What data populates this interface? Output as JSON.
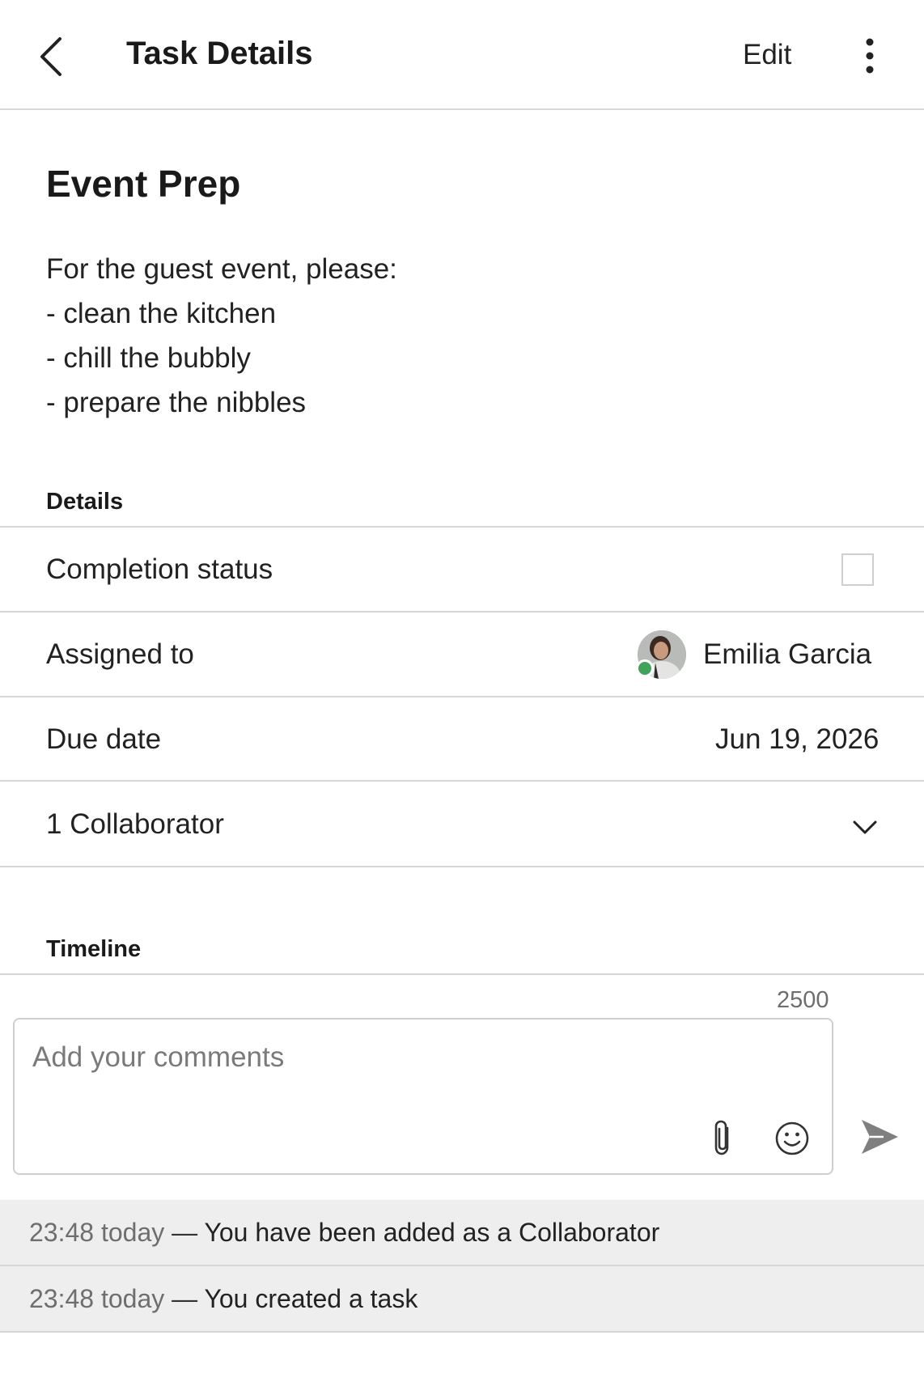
{
  "header": {
    "title": "Task Details",
    "edit_label": "Edit"
  },
  "task": {
    "title": "Event Prep",
    "description_lines": [
      "For the guest event, please:",
      "- clean the kitchen",
      "- chill the bubbly",
      "- prepare the nibbles"
    ]
  },
  "details": {
    "section_label": "Details",
    "completion_label": "Completion status",
    "completed": false,
    "assigned_label": "Assigned to",
    "assignee_name": "Emilia Garcia",
    "assignee_presence": "online",
    "due_label": "Due date",
    "due_value": "Jun 19, 2026",
    "collaborators_label": "1 Collaborator"
  },
  "timeline": {
    "section_label": "Timeline",
    "char_counter": "2500",
    "comment_placeholder": "Add your comments",
    "separator": " — ",
    "items": [
      {
        "time": "23:48 today",
        "text": "You have been added as a Collaborator"
      },
      {
        "time": "23:48 today",
        "text": "You created a task"
      }
    ]
  },
  "icons": {
    "back": "chevron-left-icon",
    "more": "vertical-ellipsis-icon",
    "expand": "chevron-down-icon",
    "attach": "paperclip-icon",
    "emoji": "smiley-icon",
    "send": "send-arrow-icon"
  },
  "colors": {
    "presence_online": "#3fa35a",
    "divider": "#d6d6d6",
    "timeline_bg": "#eeeeee"
  }
}
